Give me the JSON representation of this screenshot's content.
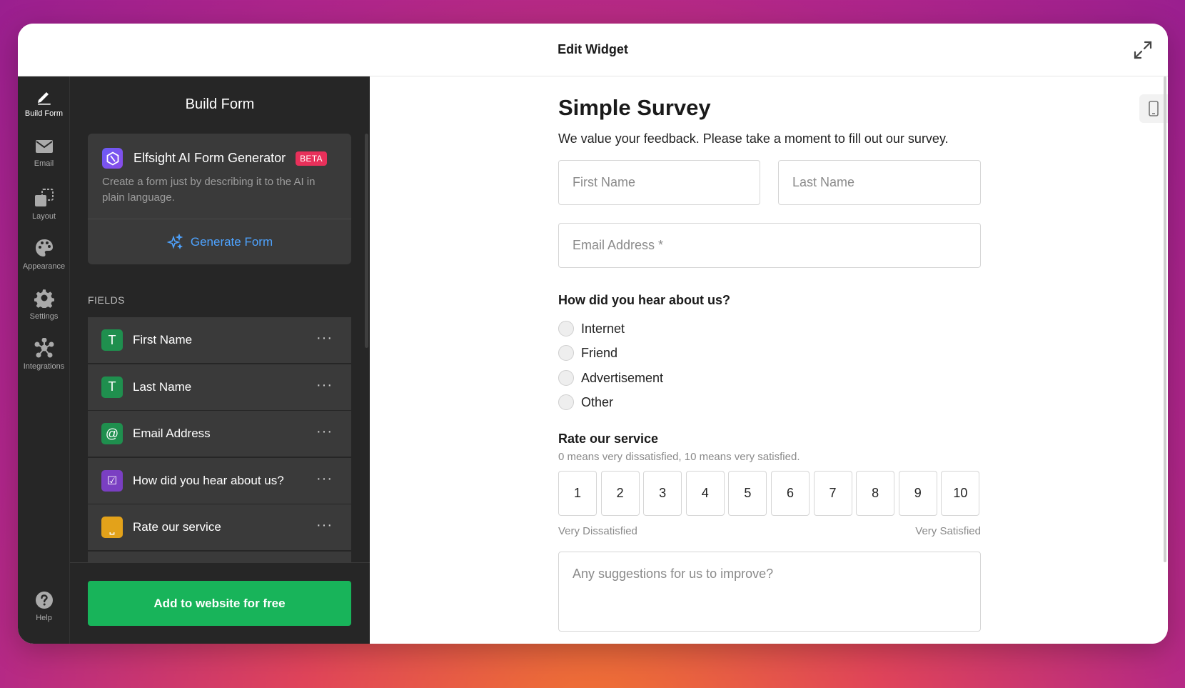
{
  "window": {
    "title": "Edit Widget"
  },
  "rail": {
    "items": [
      {
        "label": "Build Form",
        "icon": "pencil-icon",
        "active": true
      },
      {
        "label": "Email",
        "icon": "envelope-icon"
      },
      {
        "label": "Layout",
        "icon": "layout-icon"
      },
      {
        "label": "Appearance",
        "icon": "palette-icon"
      },
      {
        "label": "Settings",
        "icon": "gear-icon"
      },
      {
        "label": "Integrations",
        "icon": "integrations-icon"
      }
    ],
    "help": "Help"
  },
  "sidebar": {
    "title": "Build Form",
    "ai": {
      "name": "Elfsight AI Form Generator",
      "badge": "BETA",
      "description": "Create a form just by describing it to the AI in plain language.",
      "button": "Generate Form"
    },
    "fields_label": "FIELDS",
    "fields": [
      {
        "name": "First Name",
        "icon": "text-icon",
        "color": "#1f8f4e",
        "glyph": "T"
      },
      {
        "name": "Last Name",
        "icon": "text-icon",
        "color": "#1f8f4e",
        "glyph": "T"
      },
      {
        "name": "Email Address",
        "icon": "at-icon",
        "color": "#1f8f4e",
        "glyph": "@"
      },
      {
        "name": "How did you hear about us?",
        "icon": "checkbox-icon",
        "color": "#7a3fc2",
        "glyph": "☑"
      },
      {
        "name": "Rate our service",
        "icon": "scale-icon",
        "color": "#e3a21a",
        "glyph": "⎵"
      }
    ],
    "more": "···",
    "add_button": "Add to website for free"
  },
  "form": {
    "title": "Simple Survey",
    "description": "We value your feedback. Please take a moment to fill out our survey.",
    "first_name_placeholder": "First Name",
    "last_name_placeholder": "Last Name",
    "email_placeholder": "Email Address *",
    "source_question": "How did you hear about us?",
    "source_options": [
      "Internet",
      "Friend",
      "Advertisement",
      "Other"
    ],
    "rating_question": "Rate our service",
    "rating_hint": "0 means very dissatisfied, 10 means very satisfied.",
    "rating_values": [
      "1",
      "2",
      "3",
      "4",
      "5",
      "6",
      "7",
      "8",
      "9",
      "10"
    ],
    "rating_low": "Very Dissatisfied",
    "rating_high": "Very Satisfied",
    "suggestions_placeholder": "Any suggestions for us to improve?"
  }
}
